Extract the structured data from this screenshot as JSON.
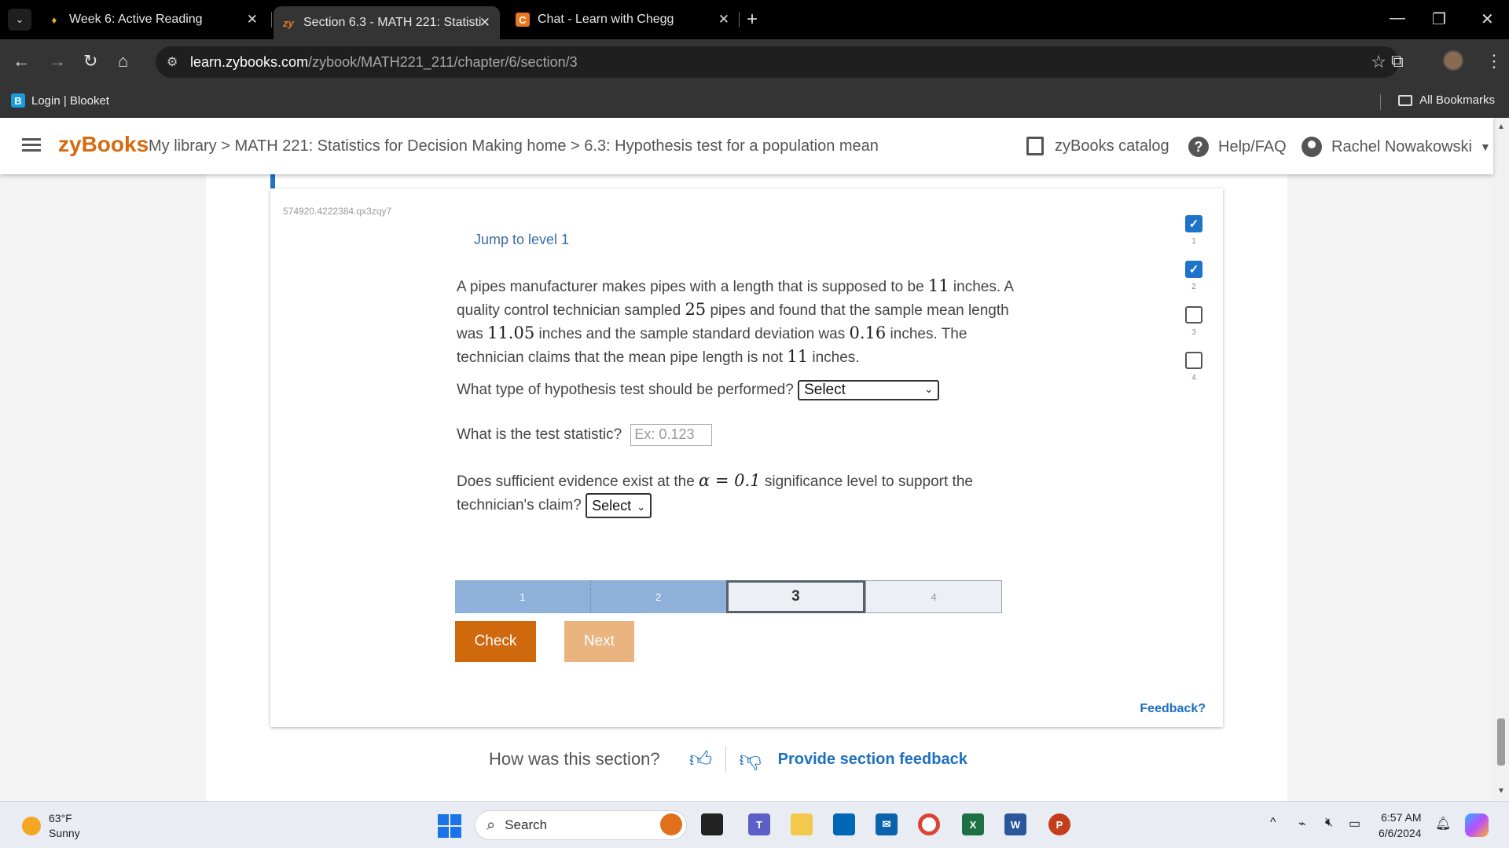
{
  "browser": {
    "tabs": [
      {
        "title": "Week 6: Active Reading",
        "icon": "canvas-shield-icon"
      },
      {
        "title": "Section 6.3 - MATH 221: Statisti",
        "icon": "zy-icon",
        "favicon_text": "zy",
        "active": true
      },
      {
        "title": "Chat - Learn with Chegg",
        "icon": "chegg-icon",
        "favicon_text": "C"
      }
    ],
    "url_host": "learn.zybooks.com",
    "url_path": "/zybook/MATH221_211/chapter/6/section/3",
    "bookmarks": [
      {
        "label": "Login | Blooket",
        "favicon_text": "B"
      }
    ],
    "all_bookmarks_label": "All Bookmarks"
  },
  "zyheader": {
    "logo": "zyBooks",
    "breadcrumb": "My library > MATH 221: Statistics for Decision Making home > 6.3: Hypothesis test for a population mean",
    "catalog": "zyBooks catalog",
    "help": "Help/FAQ",
    "user": "Rachel Nowakowski"
  },
  "activity": {
    "id": "574920.4222384.qx3zqy7",
    "jump_label": "Jump to level 1",
    "problem": {
      "p1": "A pipes manufacturer makes pipes with a length that is supposed to be ",
      "n1": "11",
      "p2": " inches. A quality control technician sampled ",
      "n2": "25",
      "p3": " pipes and found that the sample mean length was ",
      "n3": "11.05",
      "p4": " inches and the sample standard deviation was ",
      "n4": "0.16",
      "p5": " inches. The technician claims that the mean pipe length is not ",
      "n5": "11",
      "p6": " inches."
    },
    "q1_label": "What type of hypothesis test should be performed?",
    "q1_value": "Select",
    "q2_label": "What is the test statistic?",
    "q2_placeholder": "Ex: 0.123",
    "q3_pre": "Does sufficient evidence exist at the ",
    "q3_alpha": "α = 0.1",
    "q3_post": " significance level to support the",
    "q3_line2": "technician's claim?",
    "q3_value": "Select",
    "progress": [
      "1",
      "2",
      "3",
      "4"
    ],
    "current_level": 3,
    "check_label": "Check",
    "next_label": "Next",
    "feedback_label": "Feedback?",
    "levels": [
      {
        "num": "1",
        "done": true
      },
      {
        "num": "2",
        "done": true
      },
      {
        "num": "3",
        "done": false
      },
      {
        "num": "4",
        "done": false
      }
    ]
  },
  "section_feedback": {
    "question": "How was this section?",
    "link": "Provide section feedback"
  },
  "taskbar": {
    "temp": "63°F",
    "condition": "Sunny",
    "search": "Search",
    "time": "6:57 AM",
    "date": "6/6/2024"
  },
  "colors": {
    "zy_orange": "#d0680e",
    "link_blue": "#1e6fbf",
    "progress_done": "#8fb1d9"
  }
}
